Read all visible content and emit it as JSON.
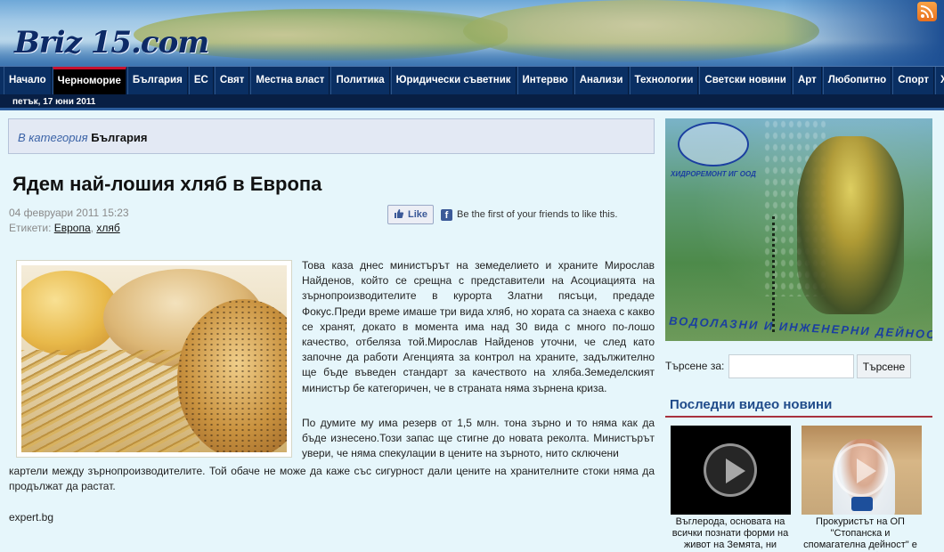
{
  "site": {
    "logo": "Briz 15.com"
  },
  "nav": {
    "items": [
      {
        "label": "Начало"
      },
      {
        "label": "Черноморие"
      },
      {
        "label": "България"
      },
      {
        "label": "ЕС"
      },
      {
        "label": "Свят"
      },
      {
        "label": "Местна власт"
      },
      {
        "label": "Политика"
      },
      {
        "label": "Юридически съветник"
      },
      {
        "label": "Интервю"
      },
      {
        "label": "Анализи"
      },
      {
        "label": "Технологии"
      },
      {
        "label": "Светски новини"
      },
      {
        "label": "Арт"
      },
      {
        "label": "Любопитно"
      },
      {
        "label": "Спорт"
      },
      {
        "label": "Хумор"
      }
    ],
    "active_index": 1
  },
  "date_bar": "петък, 17 юни 2011",
  "category": {
    "prefix": "В категория",
    "name": "България"
  },
  "article": {
    "title": "Ядем най-лошия хляб в Европа",
    "date": "04 февруари 2011 15:23",
    "tags_label": "Етикети:",
    "tags": [
      "Европа",
      "хляб"
    ],
    "p1": "Това каза днес министърът на земеделието и храните Мирослав Найденов, който се срещна с представители на Асоциацията на зърнопроизводителите в курорта Златни пясъци, предаде Фокус.Преди време имаше три вида хляб, но хората са знаеха с какво се хранят, докато в момента има над 30 вида с много по-лошо качество, отбеляза той.Мирослав Найденов уточни, че след като започне да работи Агенцията за контрол на храните, задължително ще бъде въведен стандарт за качеството на хляба.Земеделският министър бе категоричен, че в страната няма зърнена криза.",
    "p2": "По думите му има резерв от 1,5 млн. тона зърно и то няма как да бъде изнесено.Този запас ще стигне до новата реколта. Министърът увери, че няма спекулации в цените на зърното, нито сключени",
    "p3": "картели между зърнопроизводителите. Той обаче не може да каже със сигурност дали цените на хранителните стоки няма да продължат да растат.",
    "source": "expert.bg"
  },
  "facebook": {
    "like_label": "Like",
    "social_text": "Be the first of your friends to like this."
  },
  "ad": {
    "company": "ХИДРОРЕМОНТ ИГ ООД",
    "slogan": "ВОДОЛАЗНИ И ИНЖЕНЕРНИ ДЕЙНОСТИ"
  },
  "search": {
    "label": "Търсене за:",
    "value": "",
    "button": "Търсене"
  },
  "videos": {
    "heading": "Последни видео новини",
    "items": [
      {
        "caption": "Въглерода, основата на всички познати форми на живот на Земята, ни"
      },
      {
        "caption": "Прокуристът на ОП \"Стопанска и спомагателна дейност\" е подал молба за"
      }
    ]
  },
  "colors": {
    "nav_bg": "#0a2f63",
    "active_accent": "#c8102e",
    "page_bg": "#e6f6fb",
    "heading_blue": "#1f4b8a"
  }
}
